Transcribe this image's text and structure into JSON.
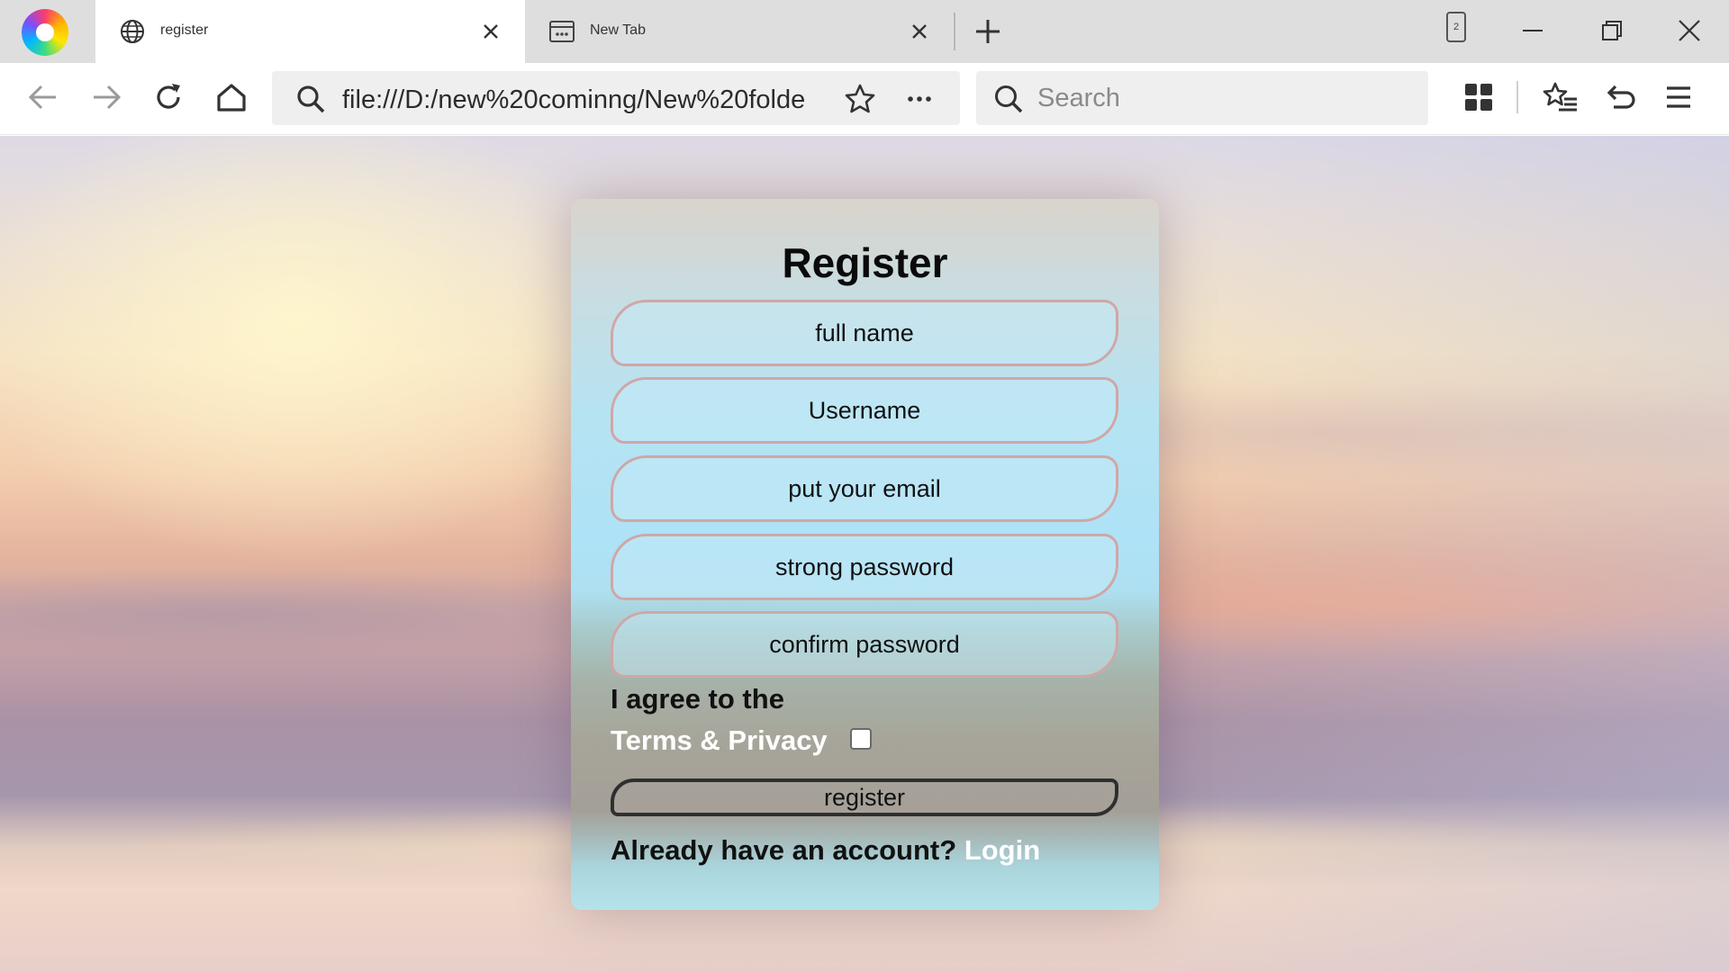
{
  "browser": {
    "tabs": [
      {
        "title": "register",
        "icon": "globe-icon",
        "active": true
      },
      {
        "title": "New Tab",
        "icon": "new-tab-page-icon",
        "active": false
      }
    ],
    "tabs_count": "2",
    "url": "file:///D:/new%20cominng/New%20folde",
    "search_placeholder": "Search"
  },
  "form": {
    "title": "Register",
    "fields": [
      {
        "placeholder": "full name"
      },
      {
        "placeholder": "Username"
      },
      {
        "placeholder": "put your email"
      },
      {
        "placeholder": "strong password"
      },
      {
        "placeholder": "confirm password"
      }
    ],
    "agree_text": "I agree to the",
    "terms_label": "Terms & Privacy",
    "agree_checked": false,
    "register_label": "register",
    "account_prompt": "Already have an account?",
    "login_label": "Login"
  }
}
